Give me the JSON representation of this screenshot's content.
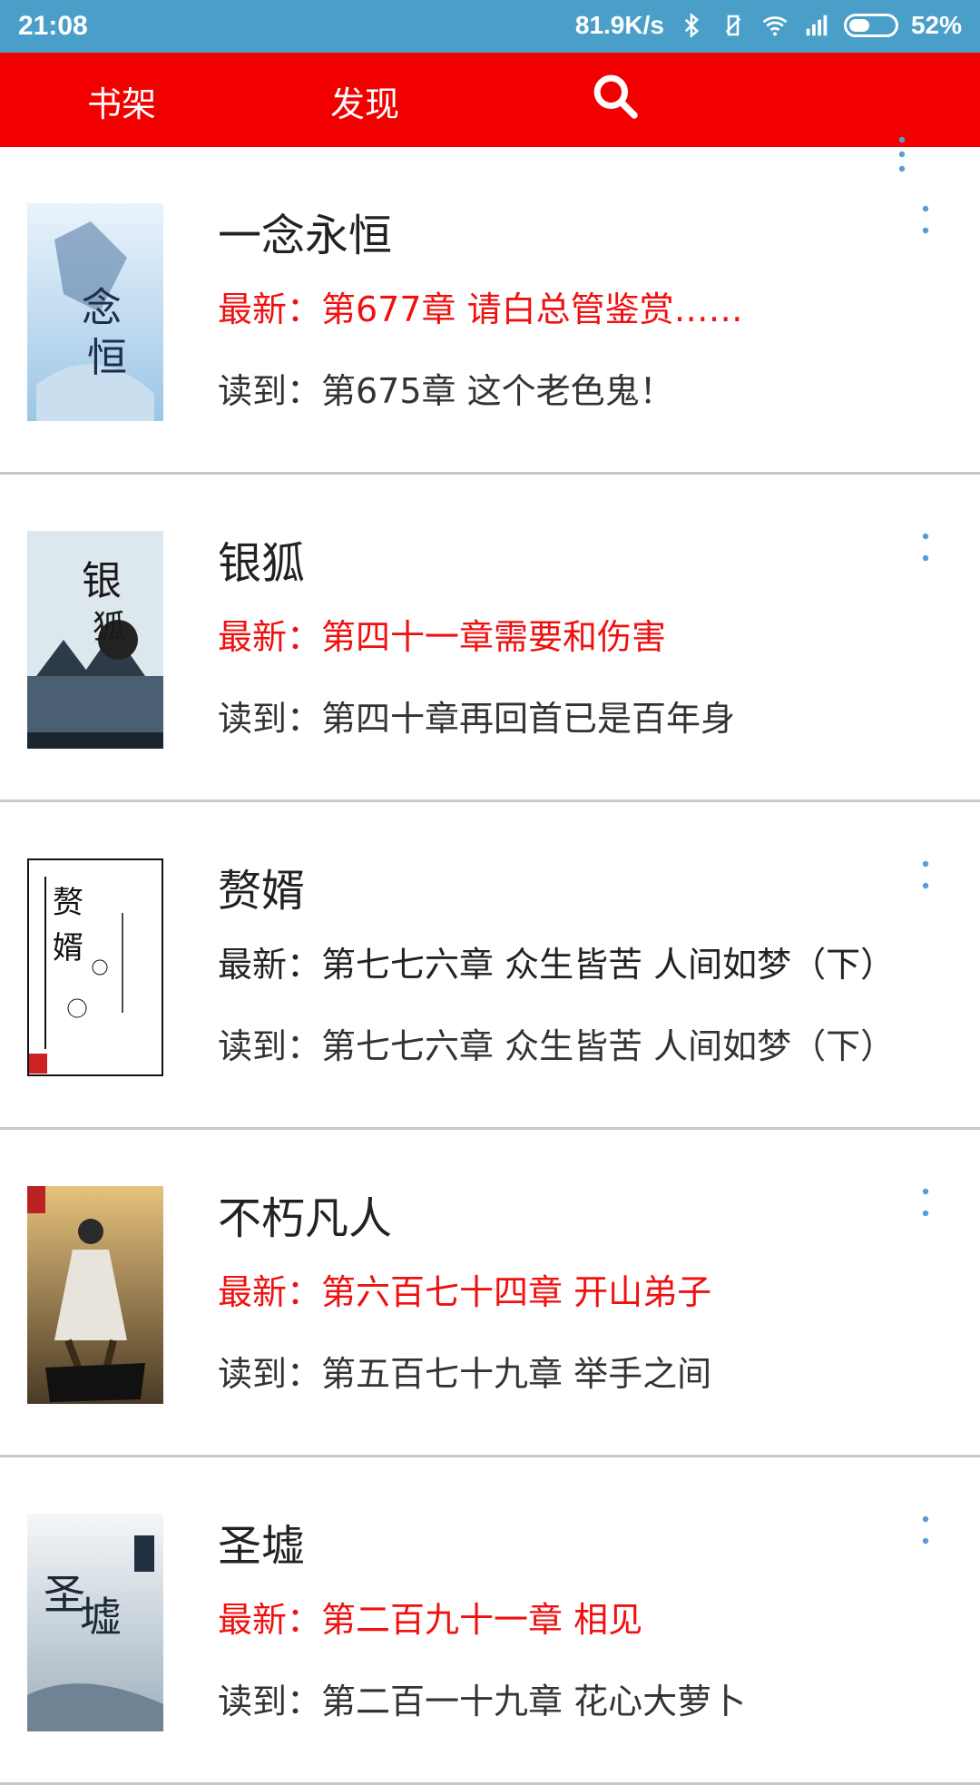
{
  "status_bar": {
    "time": "21:08",
    "net_speed": "81.9K/s",
    "battery_percent": "52%",
    "battery_level": 0.52,
    "icons": [
      "bluetooth-icon",
      "vibrate-off-icon",
      "wifi-icon",
      "signal-icon",
      "battery-icon"
    ]
  },
  "toolbar": {
    "tab_bookshelf": "书架",
    "tab_discover": "发现",
    "search_icon": "search-icon",
    "overflow_icon": "more-vertical-icon"
  },
  "colors": {
    "status_bar": "#4a9fc9",
    "toolbar": "#f20000",
    "latest_unread": "#f01010",
    "text": "#222222",
    "divider": "#c8c8c8"
  },
  "books": [
    {
      "title": "一念永恒",
      "latest": "最新：第677章 请白总管鉴赏……",
      "latest_unread": true,
      "progress": "读到：第675章 这个老色鬼！"
    },
    {
      "title": "银狐",
      "latest": "最新：第四十一章需要和伤害",
      "latest_unread": true,
      "progress": "读到：第四十章再回首已是百年身"
    },
    {
      "title": "赘婿",
      "latest": "最新：第七七六章 众生皆苦 人间如梦（下）",
      "latest_unread": false,
      "progress": "读到：第七七六章 众生皆苦 人间如梦（下）"
    },
    {
      "title": "不朽凡人",
      "latest": "最新：第六百七十四章 开山弟子",
      "latest_unread": true,
      "progress": "读到：第五百七十九章 举手之间"
    },
    {
      "title": "圣墟",
      "latest": "最新：第二百九十一章 相见",
      "latest_unread": true,
      "progress": "读到：第二百一十九章 花心大萝卜"
    }
  ]
}
